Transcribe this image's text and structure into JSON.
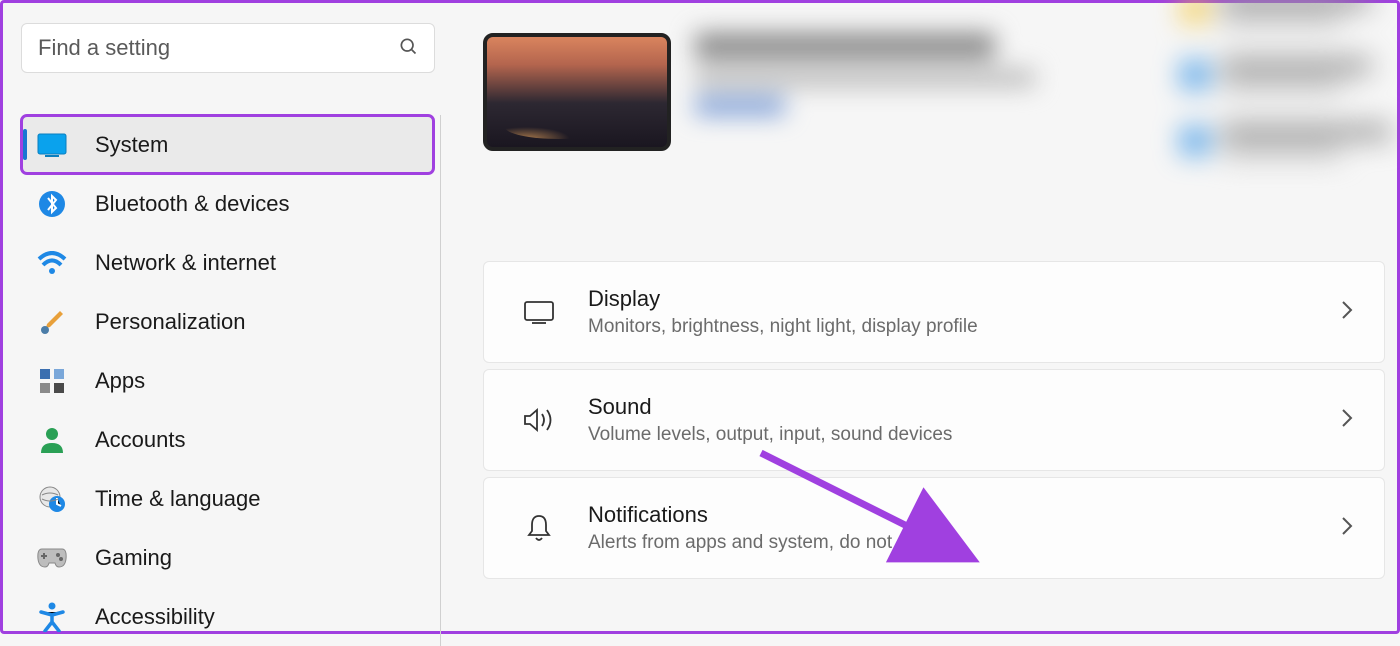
{
  "search": {
    "placeholder": "Find a setting"
  },
  "nav": {
    "items": [
      {
        "label": "System"
      },
      {
        "label": "Bluetooth & devices"
      },
      {
        "label": "Network & internet"
      },
      {
        "label": "Personalization"
      },
      {
        "label": "Apps"
      },
      {
        "label": "Accounts"
      },
      {
        "label": "Time & language"
      },
      {
        "label": "Gaming"
      },
      {
        "label": "Accessibility"
      }
    ]
  },
  "cards": [
    {
      "title": "Display",
      "subtitle": "Monitors, brightness, night light, display profile"
    },
    {
      "title": "Sound",
      "subtitle": "Volume levels, output, input, sound devices"
    },
    {
      "title": "Notifications",
      "subtitle": "Alerts from apps and system, do not disturb"
    }
  ]
}
